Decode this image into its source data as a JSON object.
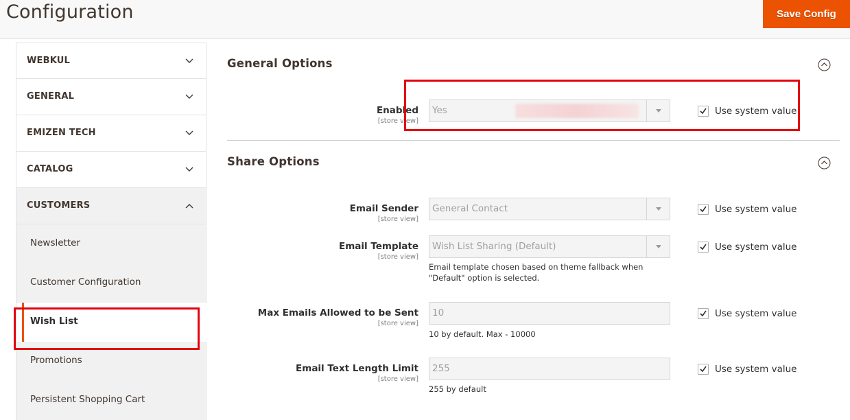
{
  "header": {
    "title": "Configuration",
    "save_button": "Save Config"
  },
  "sidebar": {
    "tabs": [
      {
        "label": "WEBKUL",
        "state": "collapsed",
        "icon": "chevron-down-icon"
      },
      {
        "label": "GENERAL",
        "state": "collapsed",
        "icon": "chevron-down-icon"
      },
      {
        "label": "EMIZEN TECH",
        "state": "collapsed",
        "icon": "chevron-down-icon"
      },
      {
        "label": "CATALOG",
        "state": "collapsed",
        "icon": "chevron-down-icon"
      },
      {
        "label": "CUSTOMERS",
        "state": "expanded",
        "icon": "chevron-up-icon"
      }
    ],
    "customers_items": [
      {
        "label": "Newsletter"
      },
      {
        "label": "Customer Configuration"
      },
      {
        "label": "Wish List",
        "active": true
      },
      {
        "label": "Promotions"
      },
      {
        "label": "Persistent Shopping Cart"
      }
    ]
  },
  "sections": {
    "general": {
      "title": "General Options",
      "fields": {
        "enabled": {
          "label": "Enabled",
          "scope": "[store view]",
          "value": "Yes",
          "use_system_value": "Use system value",
          "checked": true
        }
      }
    },
    "share": {
      "title": "Share Options",
      "fields": {
        "email_sender": {
          "label": "Email Sender",
          "scope": "[store view]",
          "value": "General Contact",
          "use_system_value": "Use system value",
          "checked": true
        },
        "email_template": {
          "label": "Email Template",
          "scope": "[store view]",
          "value": "Wish List Sharing (Default)",
          "note_line1": "Email template chosen based on theme fallback when",
          "note_line2": "\"Default\" option is selected.",
          "use_system_value": "Use system value",
          "checked": true
        },
        "max_emails": {
          "label": "Max Emails Allowed to be Sent",
          "scope": "[store view]",
          "value": "10",
          "note": "10 by default. Max - 10000",
          "use_system_value": "Use system value",
          "checked": true
        },
        "text_length": {
          "label": "Email Text Length Limit",
          "scope": "[store view]",
          "value": "255",
          "note": "255 by default",
          "use_system_value": "Use system value",
          "checked": true
        }
      }
    }
  },
  "colors": {
    "accent": "#eb5202",
    "highlight_box": "#e4000f"
  }
}
